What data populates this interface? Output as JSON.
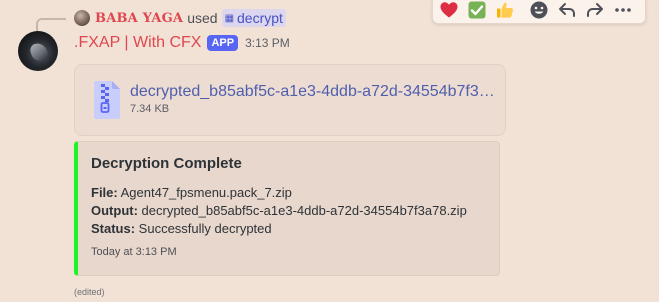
{
  "reply": {
    "username": "BABA YAGA",
    "used_text": "used",
    "command": "decrypt"
  },
  "message": {
    "username": ".FXAP | With CFX",
    "badge": "APP",
    "timestamp": "3:13 PM",
    "edited": "(edited)"
  },
  "attachment": {
    "filename": "decrypted_b85abf5c-a1e3-4ddb-a72d-34554b7f3a78.zip",
    "size": "7.34 KB"
  },
  "embed": {
    "accent_color": "#1cf524",
    "title": "Decryption Complete",
    "fields": [
      {
        "label": "File:",
        "value": " Agent47_fpsmenu.pack_7.zip"
      },
      {
        "label": "Output:",
        "value": " decrypted_b85abf5c-a1e3-4ddb-a72d-34554b7f3a78.zip"
      },
      {
        "label": "Status:",
        "value": " Successfully decrypted"
      }
    ],
    "footer": "Today at 3:13 PM"
  },
  "toolbar": {
    "reactions": [
      "heart",
      "check-mark",
      "thumbs-up"
    ],
    "actions": [
      "add-reaction",
      "reply",
      "forward",
      "more"
    ]
  },
  "colors": {
    "username": "#e0464d",
    "link": "#4f5fad",
    "badge": "#5865f2",
    "background": "#f2e2d6"
  }
}
